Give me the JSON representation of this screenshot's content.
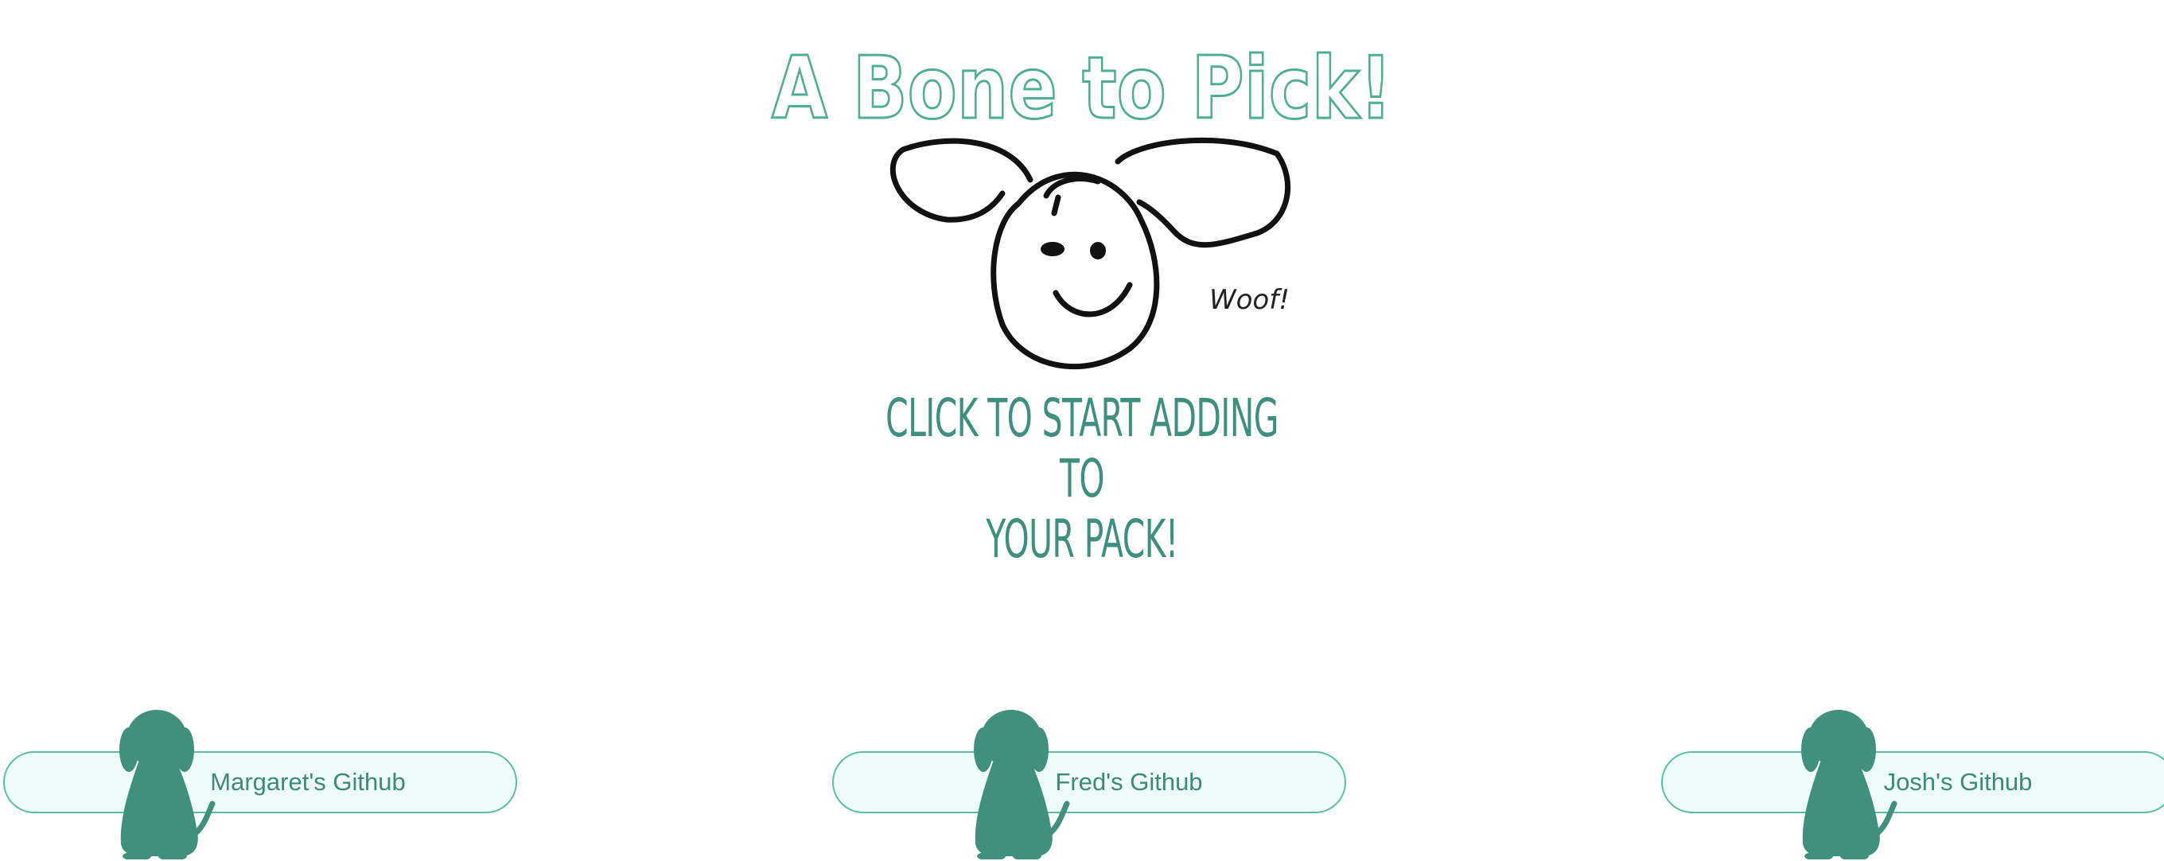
{
  "header": {
    "title": "A Bone to Pick!"
  },
  "mascot": {
    "speech": "Woof!",
    "icon": "dog-face-drawing"
  },
  "main": {
    "cta_line1": "Click to start adding to",
    "cta_line2": "your pack!"
  },
  "footer": {
    "links": [
      {
        "label": "Margaret's Github",
        "icon": "dog-silhouette-icon"
      },
      {
        "label": "Fred's Github",
        "icon": "dog-silhouette-icon"
      },
      {
        "label": "Josh's Github",
        "icon": "dog-silhouette-icon"
      }
    ]
  },
  "colors": {
    "accent": "#3e8f7f",
    "title_outline": "#4fae95",
    "button_bg": "#eefcfa",
    "button_border": "#58bfa5",
    "dog_fill": "#41907d"
  }
}
